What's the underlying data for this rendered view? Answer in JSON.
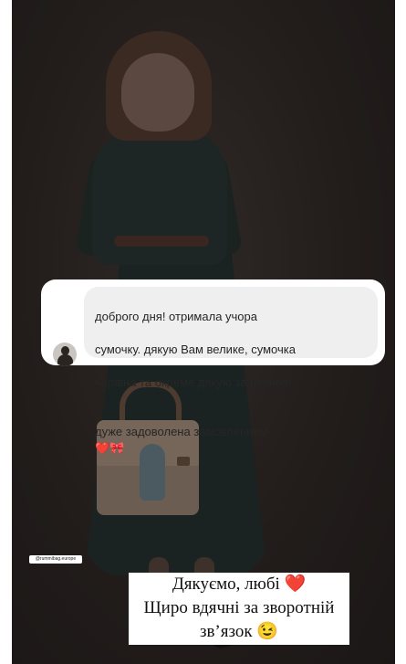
{
  "dm": {
    "line1": "доброго дня! отримала учора",
    "line2": "сумочку. дякую Вам велике, сумочка",
    "line3": "чарівна та окреме дякую за печиво!",
    "line4": "дуже задоволена замовленням",
    "heart": "❤️",
    "bow": "🎀"
  },
  "tag": {
    "username": "@rummibag.europe"
  },
  "caption": {
    "line1": "Дякуємо, любі ❤️",
    "line2": "Щиро вдячні за зворотній",
    "line3": "зв’язок 😉"
  },
  "colors": {
    "background": "#241f1d",
    "card": "#ffffff",
    "bubble": "#efefef",
    "text": "#262626"
  }
}
